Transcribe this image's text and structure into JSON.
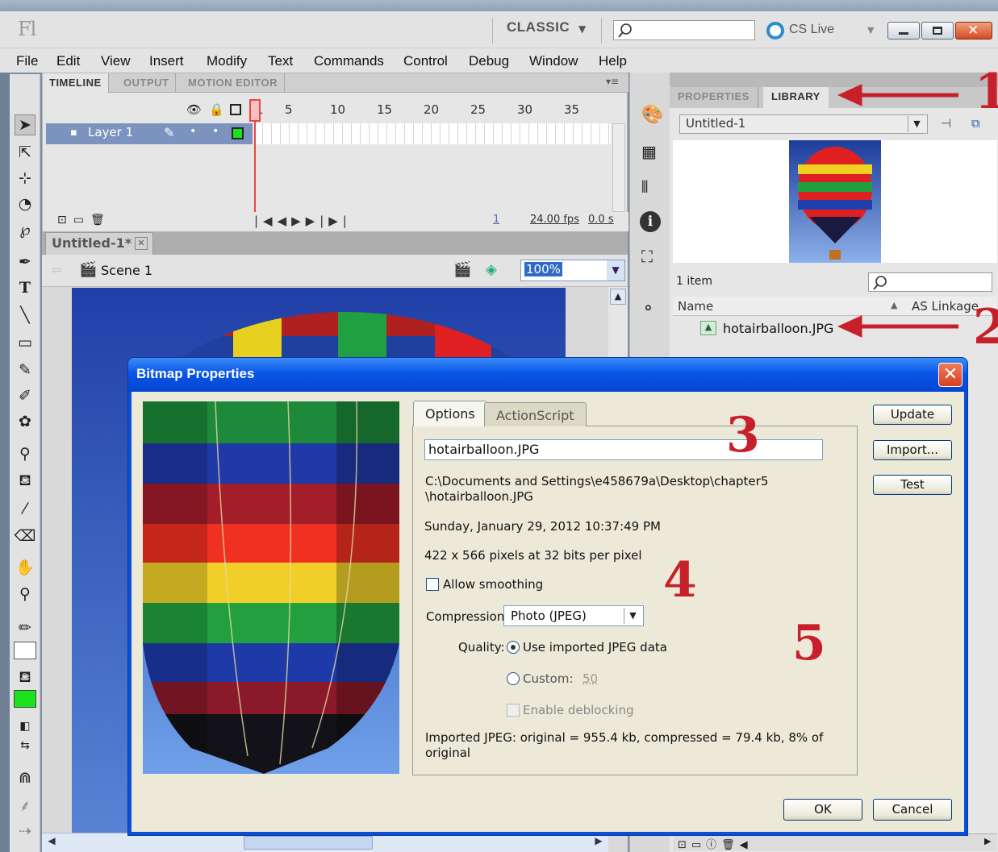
{
  "app": {
    "logo": "Fl",
    "workspace": "CLASSIC",
    "cs_live": "CS Live"
  },
  "menu": [
    "File",
    "Edit",
    "View",
    "Insert",
    "Modify",
    "Text",
    "Commands",
    "Control",
    "Debug",
    "Window",
    "Help"
  ],
  "timeline": {
    "tabs": [
      "TIMELINE",
      "OUTPUT",
      "MOTION EDITOR"
    ],
    "ruler": [
      "1",
      "5",
      "10",
      "15",
      "20",
      "25",
      "30",
      "35"
    ],
    "layer_name": "Layer 1",
    "frame": "1",
    "fps": "24.00",
    "fps_unit": "fps",
    "time": "0.0",
    "time_unit": "s"
  },
  "document": {
    "tab": "Untitled-1*",
    "scene": "Scene 1",
    "zoom": "100%"
  },
  "right_panel": {
    "tabs": [
      "PROPERTIES",
      "LIBRARY"
    ],
    "library_select": "Untitled-1",
    "item_count": "1 item",
    "col_name": "Name",
    "col_linkage": "AS Linkage",
    "item": "hotairballoon.JPG"
  },
  "dialog": {
    "title": "Bitmap Properties",
    "tabs": [
      "Options",
      "ActionScript"
    ],
    "name_value": "hotairballoon.JPG",
    "path_line1": "C:\\Documents and Settings\\e458679a\\Desktop\\chapter5",
    "path_line2": "\\hotairballoon.JPG",
    "date": "Sunday, January 29, 2012  10:37:49 PM",
    "dimensions": "422 x 566 pixels at 32 bits per pixel",
    "allow_smoothing": "Allow smoothing",
    "compression_label": "Compression:",
    "compression_value": "Photo (JPEG)",
    "quality_label": "Quality:",
    "use_imported": "Use imported JPEG data",
    "custom_label": "Custom:",
    "custom_value": "50",
    "deblocking": "Enable deblocking",
    "info_line1": "Imported JPEG: original = 955.4 kb, compressed = 79.4 kb, 8% of",
    "info_line2": "original",
    "buttons": {
      "update": "Update",
      "import": "Import...",
      "test": "Test",
      "ok": "OK",
      "cancel": "Cancel"
    }
  },
  "annotations": [
    "1",
    "2",
    "3",
    "4",
    "5"
  ],
  "colors": {
    "annotation": "#c8202a",
    "title_bar": "#0a56e8",
    "selection": "#316ac5"
  }
}
